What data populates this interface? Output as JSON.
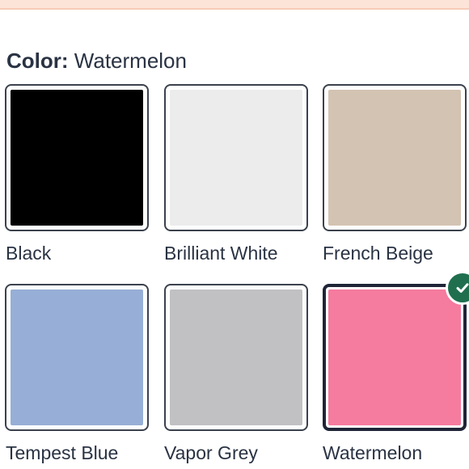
{
  "heading": {
    "label": "Color:",
    "selected_value": "Watermelon"
  },
  "swatches": [
    {
      "name": "Black",
      "color": "#000000",
      "selected": false
    },
    {
      "name": "Brilliant White",
      "color": "#ececec",
      "selected": false
    },
    {
      "name": "French Beige",
      "color": "#d3c3b2",
      "selected": false
    },
    {
      "name": "Tempest Blue",
      "color": "#97afd6",
      "selected": false
    },
    {
      "name": "Vapor Grey",
      "color": "#c1c1c4",
      "selected": false
    },
    {
      "name": "Watermelon",
      "color": "#f57b9f",
      "selected": true
    }
  ],
  "accent_colors": {
    "selected_border": "#1f2537",
    "check_badge": "#1f6f4f",
    "banner": "#fde4d8"
  },
  "icons": {
    "selected_check": "check-circle-icon"
  }
}
